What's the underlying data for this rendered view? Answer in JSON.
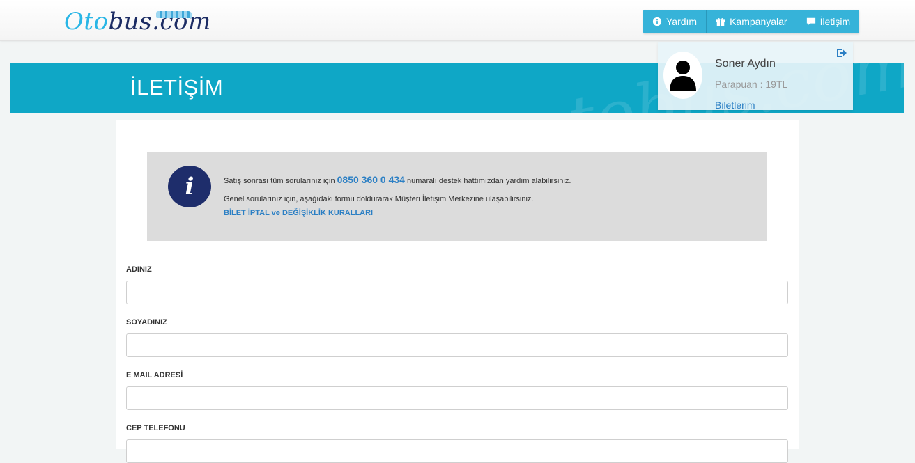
{
  "header": {
    "logo_part1": "Oto",
    "logo_part2": "bus.com",
    "nav": [
      {
        "label": "Yardım",
        "icon": "info-circle-icon"
      },
      {
        "label": "Kampanyalar",
        "icon": "gift-icon"
      },
      {
        "label": "İletişim",
        "icon": "comment-icon"
      }
    ]
  },
  "banner": {
    "title": "İLETİŞİM",
    "watermark": "otobus.com"
  },
  "user": {
    "name": "Soner Aydın",
    "points": "Parapuan : 19TL",
    "tickets_link": "Biletlerim",
    "logout_icon": "sign-out-icon"
  },
  "info": {
    "line1_before": "Satış sonrası tüm sorularınız için ",
    "phone": "0850 360 0 434",
    "line1_after": " numaralı destek hattımızdan yardım alabilirsiniz.",
    "line2": "Genel sorularınız için, aşağıdaki formu doldurarak Müşteri İletişim Merkezine ulaşabilirsiniz.",
    "link": "BİLET İPTAL ve DEĞİŞİKLİK KURALLARI",
    "icon_glyph": "i"
  },
  "form": {
    "fields": [
      {
        "label": "ADINIZ",
        "value": ""
      },
      {
        "label": "SOYADINIZ",
        "value": ""
      },
      {
        "label": "E MAIL ADRESİ",
        "value": ""
      },
      {
        "label": "CEP TELEFONU",
        "value": ""
      }
    ]
  },
  "colors": {
    "banner": "#0fa7c6",
    "nav_button": "#36b3d9",
    "link": "#2b7fc4",
    "info_icon": "#1e2d6b"
  }
}
